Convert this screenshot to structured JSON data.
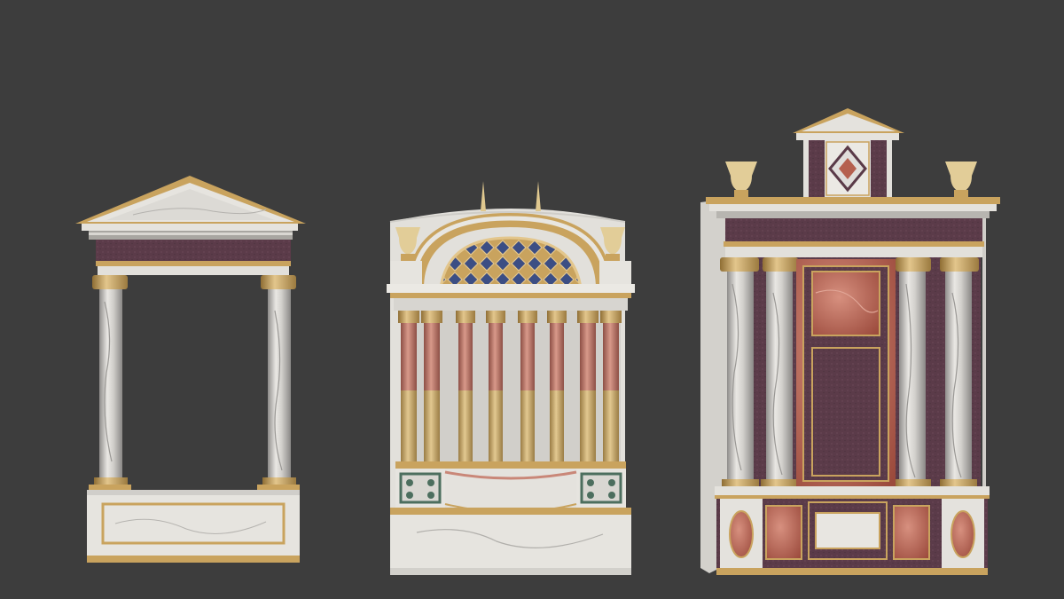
{
  "viewport": {
    "background": "#3d3d3d"
  },
  "palette": {
    "marble": "#e4e2dd",
    "marble_vein": "#a9a7a4",
    "gold": "#c9a35e",
    "gold_light": "#e3c68c",
    "porphyry": "#5a3a48",
    "red_marble": "#b5604f",
    "pink_flute": "#c98778",
    "lapis": "#3c4e84",
    "green_marble": "#4c6e5e",
    "urn": "#e2cd98",
    "shadow_wall": "#d6d4cf"
  },
  "models": [
    {
      "name": "tempietto-aedicule"
    },
    {
      "name": "domed-colonnade-niche"
    },
    {
      "name": "porphyry-altarpiece"
    }
  ]
}
